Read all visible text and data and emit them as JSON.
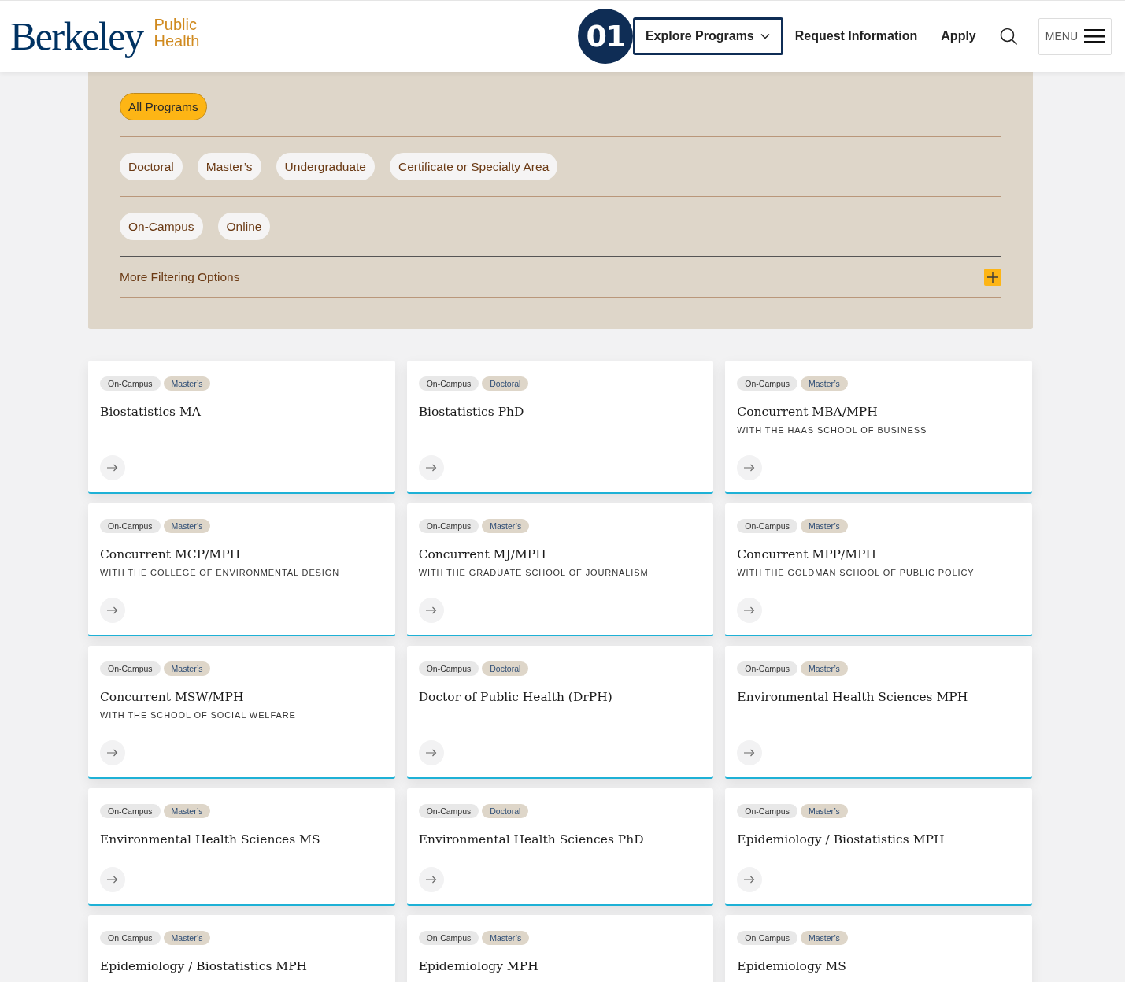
{
  "header": {
    "logo_word": "Berkeley",
    "logo_sub": [
      "Public",
      "Health"
    ],
    "step_badge": "01",
    "nav": [
      {
        "label": "Explore Programs",
        "kind": "dropdown",
        "selected": true
      },
      {
        "label": "Request Information",
        "kind": "link",
        "selected": false
      },
      {
        "label": "Apply",
        "kind": "link",
        "selected": false
      }
    ],
    "menu_label": "MENU"
  },
  "filters": {
    "groups": [
      [
        {
          "label": "All Programs",
          "selected": true
        }
      ],
      [
        {
          "label": "Doctoral",
          "selected": false
        },
        {
          "label": "Master’s",
          "selected": false
        },
        {
          "label": "Undergraduate",
          "selected": false
        },
        {
          "label": "Certificate or Specialty Area",
          "selected": false
        }
      ],
      [
        {
          "label": "On-Campus",
          "selected": false
        },
        {
          "label": "Online",
          "selected": false
        }
      ]
    ],
    "more": {
      "label": "More Filtering Options",
      "expanded": false
    }
  },
  "programs": [
    {
      "tags": [
        {
          "label": "On-Campus",
          "kind": "format"
        },
        {
          "label": "Master’s",
          "kind": "level"
        }
      ],
      "title": "Biostatistics MA",
      "link": true
    },
    {
      "tags": [
        {
          "label": "On-Campus",
          "kind": "format"
        },
        {
          "label": "Doctoral",
          "kind": "level"
        }
      ],
      "title": "Biostatistics PhD",
      "link": true
    },
    {
      "tags": [
        {
          "label": "On-Campus",
          "kind": "format"
        },
        {
          "label": "Master’s",
          "kind": "level"
        }
      ],
      "title": "Concurrent MBA/MPH",
      "subtitle": "WITH THE HAAS SCHOOL OF BUSINESS",
      "link": true
    },
    {
      "tags": [
        {
          "label": "On-Campus",
          "kind": "format"
        },
        {
          "label": "Master’s",
          "kind": "level"
        }
      ],
      "title": "Concurrent MCP/MPH",
      "subtitle": "WITH THE COLLEGE OF ENVIRONMENTAL DESIGN",
      "link": true
    },
    {
      "tags": [
        {
          "label": "On-Campus",
          "kind": "format"
        },
        {
          "label": "Master’s",
          "kind": "level"
        }
      ],
      "title": "Concurrent MJ/MPH",
      "subtitle": "WITH THE GRADUATE SCHOOL OF JOURNALISM",
      "link": true
    },
    {
      "tags": [
        {
          "label": "On-Campus",
          "kind": "format"
        },
        {
          "label": "Master’s",
          "kind": "level"
        }
      ],
      "title": "Concurrent MPP/MPH",
      "subtitle": "WITH THE GOLDMAN SCHOOL OF PUBLIC POLICY",
      "link": true
    },
    {
      "tags": [
        {
          "label": "On-Campus",
          "kind": "format"
        },
        {
          "label": "Master’s",
          "kind": "level"
        }
      ],
      "title": "Concurrent MSW/MPH",
      "subtitle": "WITH THE SCHOOL OF SOCIAL WELFARE",
      "link": true
    },
    {
      "tags": [
        {
          "label": "On-Campus",
          "kind": "format"
        },
        {
          "label": "Doctoral",
          "kind": "level"
        }
      ],
      "title": "Doctor of Public Health (DrPH)",
      "link": true
    },
    {
      "tags": [
        {
          "label": "On-Campus",
          "kind": "format"
        },
        {
          "label": "Master’s",
          "kind": "level"
        }
      ],
      "title": "Environmental Health Sciences MPH",
      "link": true
    },
    {
      "tags": [
        {
          "label": "On-Campus",
          "kind": "format"
        },
        {
          "label": "Master’s",
          "kind": "level"
        }
      ],
      "title": "Environmental Health Sciences MS",
      "link": true
    },
    {
      "tags": [
        {
          "label": "On-Campus",
          "kind": "format"
        },
        {
          "label": "Doctoral",
          "kind": "level"
        }
      ],
      "title": "Environmental Health Sciences PhD",
      "link": true
    },
    {
      "tags": [
        {
          "label": "On-Campus",
          "kind": "format"
        },
        {
          "label": "Master’s",
          "kind": "level"
        }
      ],
      "title": "Epidemiology / Biostatistics MPH",
      "link": true
    },
    {
      "tags": [
        {
          "label": "On-Campus",
          "kind": "format"
        },
        {
          "label": "Master’s",
          "kind": "level"
        }
      ],
      "title": "Epidemiology / Biostatistics MPH"
    },
    {
      "tags": [
        {
          "label": "On-Campus",
          "kind": "format"
        },
        {
          "label": "Master’s",
          "kind": "level"
        }
      ],
      "title": "Epidemiology MPH"
    },
    {
      "tags": [
        {
          "label": "On-Campus",
          "kind": "format"
        },
        {
          "label": "Master’s",
          "kind": "level"
        }
      ],
      "title": "Epidemiology MS"
    }
  ]
}
